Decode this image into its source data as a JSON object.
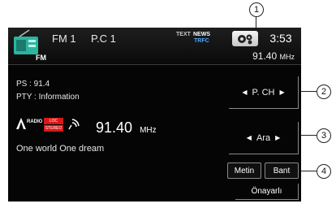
{
  "header": {
    "band": "FM 1",
    "preset": "P.C 1",
    "text_indicator": "TEXT",
    "news_indicator": "NEWS",
    "trfc_indicator": "TRFC",
    "clock": "3:53",
    "frequency": "91.40",
    "frequency_unit": "MHz",
    "source_badge": "FM"
  },
  "info": {
    "ps": "PS   : 91.4",
    "pty": "PTY : Information",
    "radio_tag": "RADIO",
    "loc_badge": "LOC",
    "stereo_badge": "STEREO",
    "frequency": "91.40",
    "frequency_unit": "MHz",
    "radio_text": "One world One dream"
  },
  "controls": {
    "pch_label": "P. CH",
    "ara_label": "Ara",
    "metin_label": "Metin",
    "bant_label": "Bant",
    "onayarli_label": "Önayarlı"
  },
  "callouts": [
    "1",
    "2",
    "3",
    "4"
  ],
  "icons": [
    "radio-icon",
    "gear-icon",
    "signal-icon",
    "antenna-icon",
    "left-arrow-icon",
    "right-arrow-icon"
  ],
  "colors": {
    "screen_bg": "#050505",
    "badge_red": "#d81818",
    "trfc_blue": "#4ea8ff",
    "text": "#e8e8e8"
  }
}
